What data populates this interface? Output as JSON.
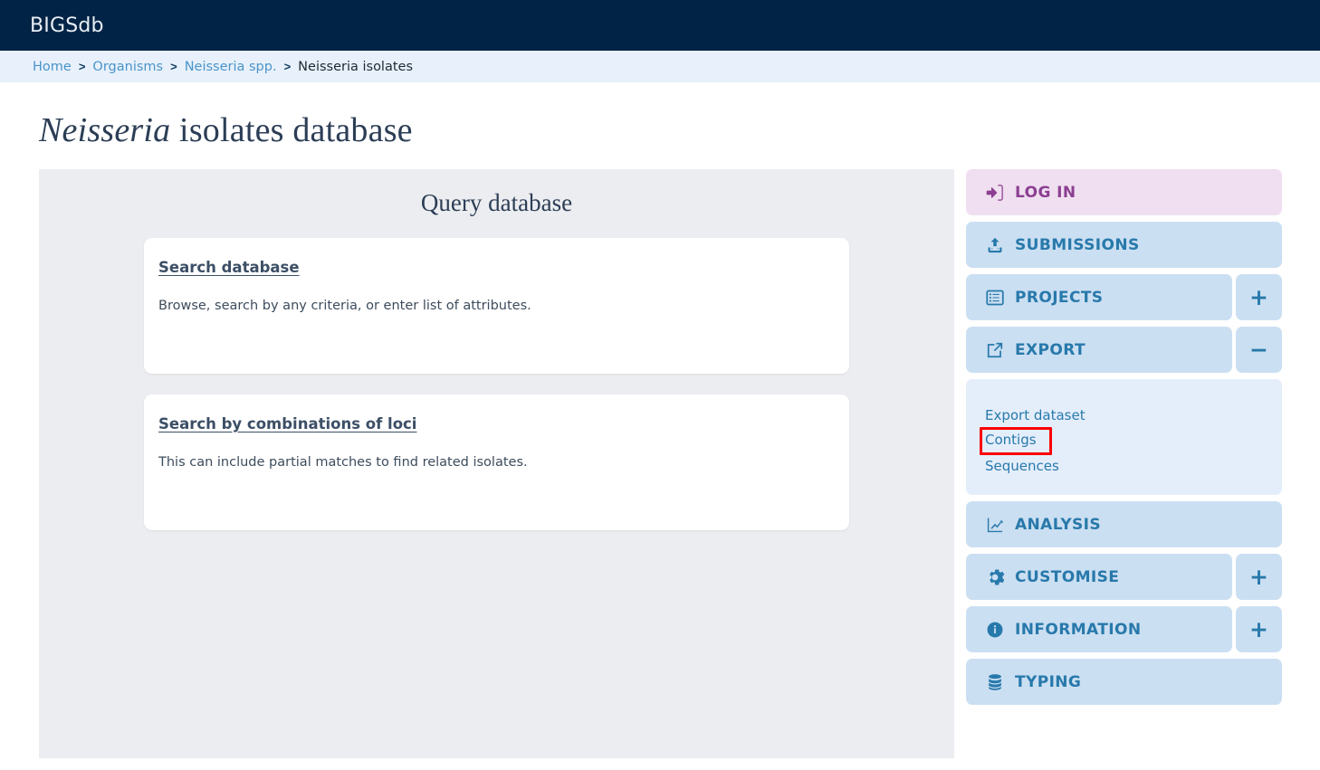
{
  "header": {
    "brand": "BIGSdb"
  },
  "breadcrumb": {
    "separator": ">",
    "items": [
      {
        "label": "Home",
        "current": false
      },
      {
        "label": "Organisms",
        "current": false
      },
      {
        "label": "Neisseria spp.",
        "current": false
      },
      {
        "label": "Neisseria isolates",
        "current": true
      }
    ]
  },
  "page": {
    "title_species": "Neisseria",
    "title_rest": " isolates database"
  },
  "main": {
    "heading": "Query database",
    "cards": [
      {
        "title": "Search database",
        "description": "Browse, search by any criteria, or enter list of attributes."
      },
      {
        "title": "Search by combinations of loci",
        "description": "This can include partial matches to find related isolates."
      }
    ]
  },
  "sidebar": {
    "items": [
      {
        "label": "LOG IN",
        "icon": "sign-in-icon",
        "toggle": null,
        "style": "login"
      },
      {
        "label": "SUBMISSIONS",
        "icon": "upload-icon",
        "toggle": null,
        "style": "default"
      },
      {
        "label": "PROJECTS",
        "icon": "list-icon",
        "toggle": "+",
        "style": "default"
      },
      {
        "label": "EXPORT",
        "icon": "external-link-icon",
        "toggle": "−",
        "style": "default"
      },
      {
        "label": "ANALYSIS",
        "icon": "chart-line-icon",
        "toggle": null,
        "style": "default"
      },
      {
        "label": "CUSTOMISE",
        "icon": "gear-icon",
        "toggle": "+",
        "style": "default"
      },
      {
        "label": "INFORMATION",
        "icon": "info-circle-icon",
        "toggle": "+",
        "style": "default"
      },
      {
        "label": "TYPING",
        "icon": "database-icon",
        "toggle": null,
        "style": "default"
      }
    ],
    "export_submenu": [
      {
        "label": "Export dataset",
        "highlighted": false
      },
      {
        "label": "Contigs",
        "highlighted": true
      },
      {
        "label": "Sequences",
        "highlighted": false
      }
    ]
  },
  "colors": {
    "header_bg": "#012345",
    "breadcrumb_bg": "#e8f1fb",
    "panel_bg": "#ecedf0",
    "sidebar_btn": "#cbdff2",
    "sidebar_login_btn": "#efdff0",
    "sidebar_text": "#2879ab",
    "login_text": "#8c3f92",
    "submenu_bg": "#e4eefb",
    "highlight_border": "#fb0007"
  }
}
